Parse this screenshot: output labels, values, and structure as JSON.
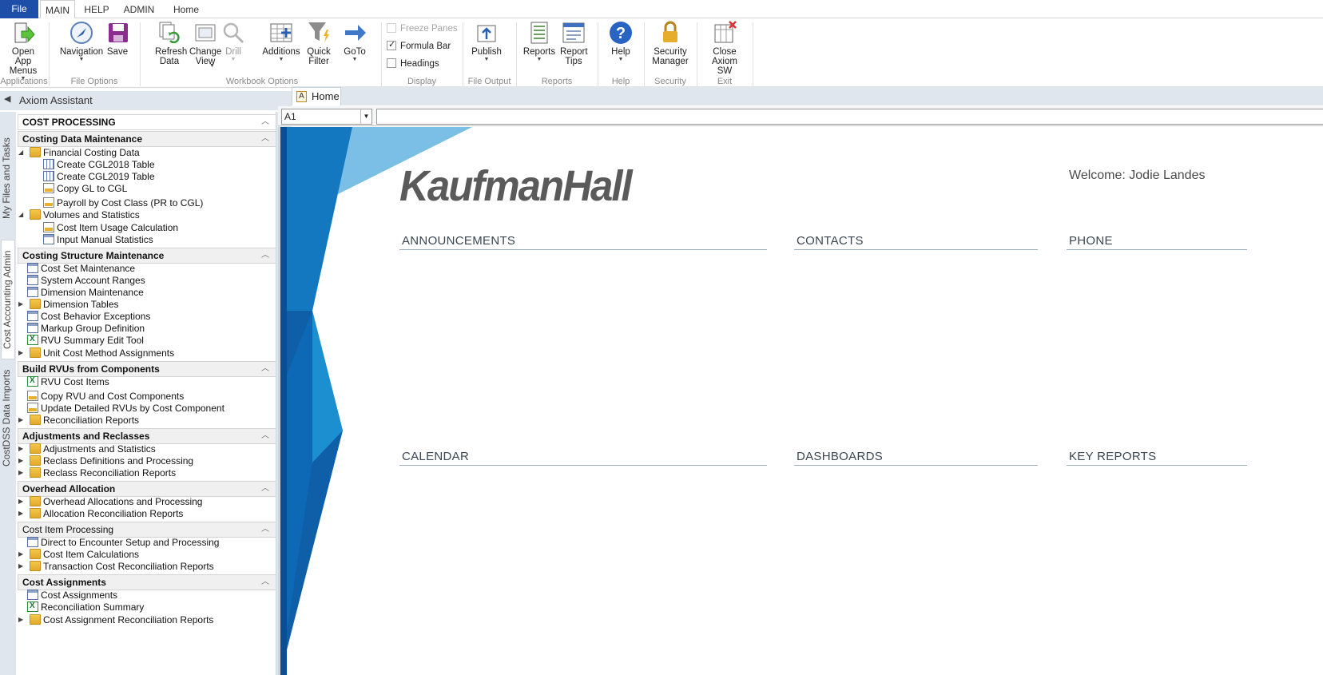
{
  "ribbon_tabs": {
    "file": "File",
    "main": "MAIN",
    "help": "HELP",
    "admin": "ADMIN",
    "home": "Home"
  },
  "ribbon": {
    "open_app_menus": "Open App Menus",
    "navigation": "Navigation",
    "save": "Save",
    "refresh_data": "Refresh Data",
    "change_view": "Change View",
    "drill": "Drill",
    "additions": "Additions",
    "quick_filter": "Quick Filter",
    "goto": "GoTo",
    "freeze_panes": "Freeze Panes",
    "formula_bar": "Formula Bar",
    "headings": "Headings",
    "publish": "Publish",
    "reports": "Reports",
    "report_tips": "Report Tips",
    "help": "Help",
    "security_manager": "Security Manager",
    "close_axiom": "Close Axiom SW",
    "groups": {
      "applications": "Applications",
      "file_options": "File Options",
      "workbook_options": "Workbook Options",
      "display": "Display",
      "file_output": "File Output",
      "reports": "Reports",
      "help": "Help",
      "security": "Security",
      "exit": "Exit"
    },
    "checkbox_state": {
      "freeze_panes": false,
      "formula_bar": true,
      "headings": false
    }
  },
  "assistant": {
    "title": "Axiom Assistant"
  },
  "side_tabs": {
    "my_files": "My Files and Tasks",
    "cost_accounting": "Cost Accounting Admin",
    "costdss": "CostDSS Data Imports"
  },
  "nav": {
    "top": "COST PROCESSING",
    "costing_data_maintenance": "Costing Data Maintenance",
    "financial_costing_data": "Financial Costing Data",
    "create_cgl2018": "Create CGL2018 Table",
    "create_cgl2019": "Create CGL2019 Table",
    "copy_gl": "Copy GL to CGL",
    "payroll": "Payroll by Cost Class (PR to CGL)",
    "volumes": "Volumes and Statistics",
    "cost_item_usage": "Cost Item Usage Calculation",
    "input_manual": "Input Manual Statistics",
    "costing_structure": "Costing Structure Maintenance",
    "cost_set": "Cost Set Maintenance",
    "system_account": "System Account Ranges",
    "dimension_maint": "Dimension Maintenance",
    "dimension_tables": "Dimension Tables",
    "cost_behavior": "Cost Behavior Exceptions",
    "markup_group": "Markup Group Definition",
    "rvu_summary": "RVU Summary Edit Tool",
    "unit_cost": "Unit Cost Method Assignments",
    "build_rvus": "Build RVUs from Components",
    "rvu_cost_items": "RVU Cost Items",
    "copy_rvu": "Copy RVU and Cost Components",
    "update_detailed": "Update Detailed RVUs by Cost Component",
    "reconciliation_reports": "Reconciliation Reports",
    "adjustments_reclasses": "Adjustments and Reclasses",
    "adjustments_statistics": "Adjustments and Statistics",
    "reclass_definitions": "Reclass Definitions and Processing",
    "reclass_recon": "Reclass Reconciliation Reports",
    "overhead_allocation": "Overhead Allocation",
    "overhead_allocations": "Overhead Allocations and Processing",
    "allocation_recon": "Allocation Reconciliation Reports",
    "cost_item_processing": "Cost Item Processing",
    "direct_encounter": "Direct to Encounter Setup and Processing",
    "cost_item_calcs": "Cost Item Calculations",
    "transaction_cost": "Transaction Cost Reconciliation Reports",
    "cost_assignments_head": "Cost Assignments",
    "cost_assignments": "Cost Assignments",
    "reconciliation_summary": "Reconciliation Summary",
    "cost_assignment_recon": "Cost Assignment Reconciliation Reports"
  },
  "doc_tab": {
    "icon": "A",
    "label": "Home"
  },
  "formula": {
    "cell_ref": "A1",
    "value": ""
  },
  "home": {
    "logo": "KaufmanHall",
    "welcome": "Welcome: Jodie Landes",
    "announcements": "ANNOUNCEMENTS",
    "contacts": "CONTACTS",
    "phone": "PHONE",
    "calendar": "CALENDAR",
    "dashboards": "DASHBOARDS",
    "key_reports": "KEY REPORTS"
  },
  "colors": {
    "file_tab": "#1e4fa8",
    "panel_bg": "#dfe6ee",
    "deco_blue_dark": "#0f5fa8",
    "deco_blue_light": "#5cb8e2"
  }
}
